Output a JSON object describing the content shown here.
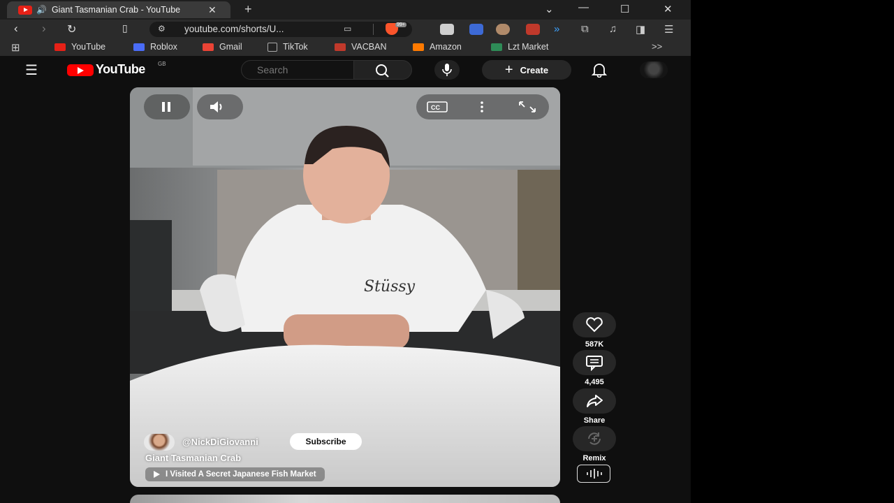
{
  "browser": {
    "tab": {
      "title": "Giant Tasmanian Crab - YouTube"
    },
    "omnibox": {
      "url": "youtube.com/shorts/U...",
      "brave_badge": "99+"
    },
    "bookmarks": [
      {
        "label": "YouTube",
        "color": "#e62117"
      },
      {
        "label": "Roblox",
        "color": "#4a6cf7"
      },
      {
        "label": "Gmail",
        "color": "#ea4335"
      },
      {
        "label": "TikTok",
        "color": "#222222"
      },
      {
        "label": "VACBAN",
        "color": "#c0392b"
      },
      {
        "label": "Amazon",
        "color": "#ff7a00"
      },
      {
        "label": "Lzt Market",
        "color": "#2e8b57"
      }
    ],
    "more_icon": ">>"
  },
  "youtube": {
    "logo_text": "YouTube",
    "region": "GB",
    "search_placeholder": "Search",
    "create_label": "Create"
  },
  "short": {
    "channel": "@NickDiGiovanni",
    "subscribe_label": "Subscribe",
    "title": "Giant Tasmanian Crab",
    "related_video": "I Visited A Secret Japanese Fish Market",
    "shirt_text": "Stüssy",
    "actions": {
      "likes": "587K",
      "comments": "4,495",
      "share": "Share",
      "remix": "Remix"
    }
  }
}
